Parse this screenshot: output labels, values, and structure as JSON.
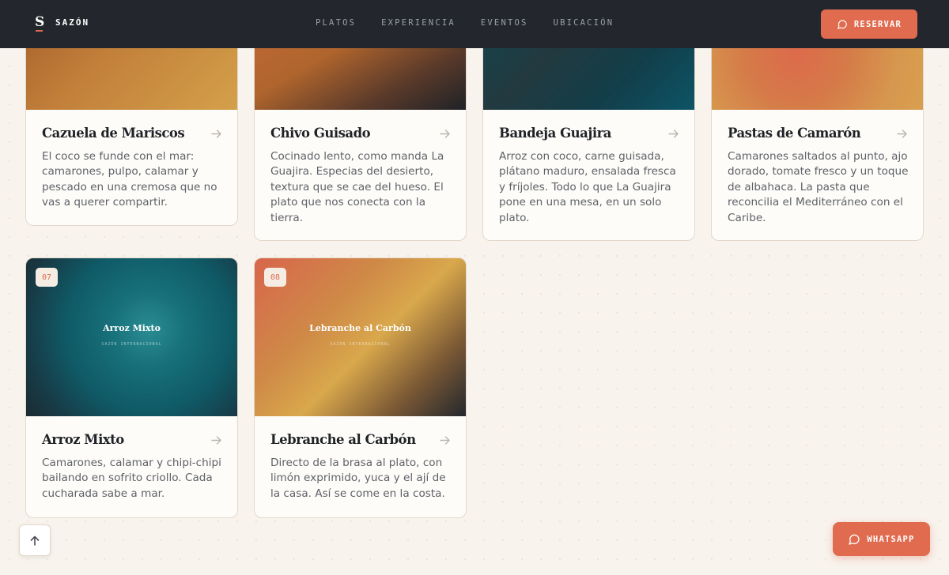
{
  "header": {
    "brand_mark": "S",
    "brand_name": "SAZÓN",
    "nav": [
      "PLATOS",
      "EXPERIENCIA",
      "EVENTOS",
      "UBICACIÓN"
    ],
    "reserve_label": "RESERVAR"
  },
  "dishes": [
    {
      "title": "Cazuela de Mariscos",
      "description": "El coco se funde con el mar: camarones, pulpo, calamar y pescado en una cremosa que no vas a querer compartir."
    },
    {
      "title": "Chivo Guisado",
      "description": "Cocinado lento, como manda La Guajira. Especias del desierto, textura que se cae del hueso. El plato que nos conecta con la tierra."
    },
    {
      "title": "Bandeja Guajira",
      "description": "Arroz con coco, carne guisada, plátano maduro, ensalada fresca y fríjoles. Todo lo que La Guajira pone en una mesa, en un solo plato."
    },
    {
      "title": "Pastas de Camarón",
      "description": "Camarones saltados al punto, ajo dorado, tomate fresco y un toque de albahaca. La pasta que reconcilia el Mediterráneo con el Caribe."
    },
    {
      "number": "07",
      "title": "Arroz Mixto",
      "image_caption": "Arroz Mixto",
      "image_subcaption": "SAZÓN INTERNACIONAL",
      "description": "Camarones, calamar y chipi-chipi bailando en sofrito criollo. Cada cucharada sabe a mar."
    },
    {
      "number": "08",
      "title": "Lebranche al Carbón",
      "image_caption": "Lebranche al Carbón",
      "image_subcaption": "SAZÓN INTERNACIONAL",
      "description": "Directo de la brasa al plato, con limón exprimido, yuca y el ají de la casa. Así se come en la costa."
    }
  ],
  "floating": {
    "whatsapp_label": "WHATSAPP"
  },
  "icons": {
    "scroll_top": "arrow-up-icon",
    "card_link": "arrow-right-icon",
    "chat": "chat-bubble-icon"
  },
  "colors": {
    "accent": "#e06b4f",
    "header_bg": "#23272d",
    "page_bg": "#f8f3ed"
  }
}
